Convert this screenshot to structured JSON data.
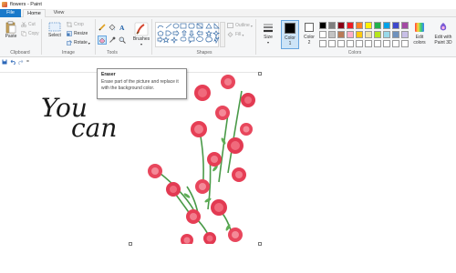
{
  "window": {
    "title": "flowers - Paint"
  },
  "tabs": [
    {
      "label": "File"
    },
    {
      "label": "Home"
    },
    {
      "label": "View"
    }
  ],
  "clipboard": {
    "paste_label": "Paste",
    "cut_label": "Cut",
    "copy_label": "Copy",
    "group_label": "Clipboard"
  },
  "image": {
    "select_label": "Select",
    "crop_label": "Crop",
    "resize_label": "Resize",
    "rotate_label": "Rotate",
    "group_label": "Image"
  },
  "tools": {
    "group_label": "Tools"
  },
  "brushes": {
    "label": "Brushes"
  },
  "shapes": {
    "outline_label": "Outline",
    "fill_label": "Fill",
    "group_label": "Shapes"
  },
  "size": {
    "label": "Size"
  },
  "colors": {
    "color1_label": "Color",
    "color1_num": "1",
    "color2_label": "Color",
    "color2_num": "2",
    "edit_label": "Edit",
    "edit_label2": "colors",
    "paint3d_label": "Edit with",
    "paint3d_label2": "Paint 3D",
    "group_label": "Colors",
    "color1_value": "#000000",
    "color2_value": "#ffffff",
    "palette_row1": [
      "#000000",
      "#7f7f7f",
      "#880015",
      "#ed1c24",
      "#ff7f27",
      "#fff200",
      "#22b14c",
      "#00a2e8",
      "#3f48cc",
      "#a349a4"
    ],
    "palette_row2": [
      "#ffffff",
      "#c3c3c3",
      "#b97a57",
      "#ffaec9",
      "#ffc90e",
      "#efe4b0",
      "#b5e61d",
      "#99d9ea",
      "#7092be",
      "#c8bfe7"
    ],
    "palette_row3": [
      "#ffffff",
      "#ffffff",
      "#ffffff",
      "#ffffff",
      "#ffffff",
      "#ffffff",
      "#ffffff",
      "#ffffff",
      "#ffffff",
      "#ffffff"
    ]
  },
  "canvas": {
    "text_line1": "You",
    "text_line2": "can"
  },
  "tooltip": {
    "title": "Eraser",
    "description": "Erase part of the picture and replace it with the background color."
  }
}
